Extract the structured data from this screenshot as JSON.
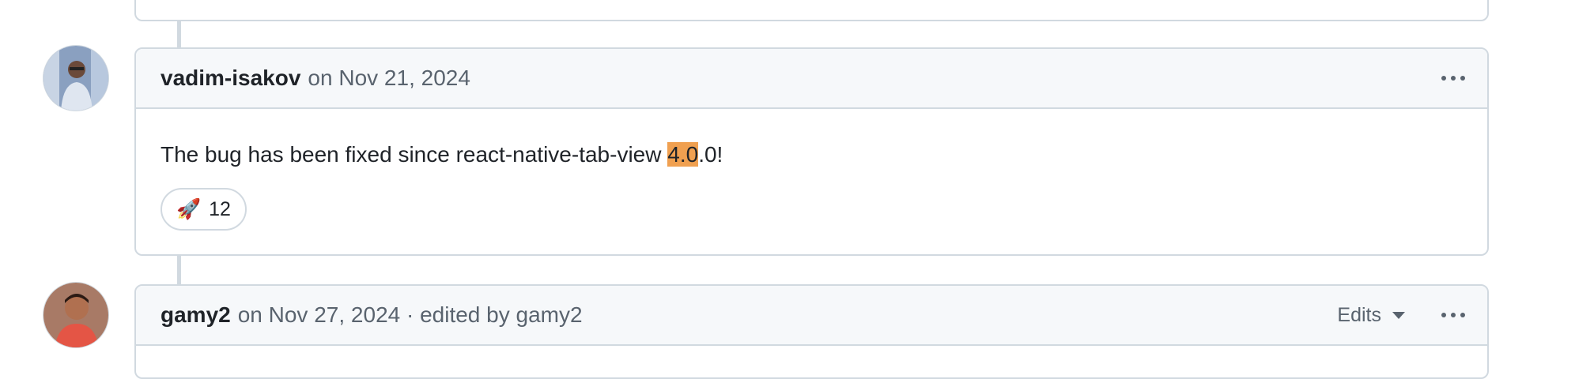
{
  "comments": [
    {
      "author": "vadim-isakov",
      "meta": "on Nov 21, 2024",
      "body_text_before": "The bug has been fixed since react-native-tab-view ",
      "body_highlight": "4.0",
      "body_text_after": ".0!",
      "reaction": {
        "emoji": "🚀",
        "count": "12"
      }
    },
    {
      "author": "gamy2",
      "meta": "on Nov 27, 2024 · edited by gamy2",
      "edits_label": "Edits"
    }
  ]
}
